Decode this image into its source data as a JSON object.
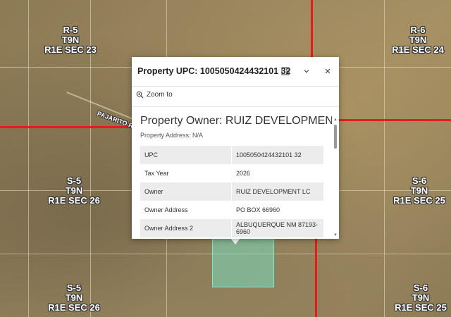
{
  "map": {
    "road_label": "PAJARITO R",
    "section_labels": [
      {
        "lines": [
          "R-5",
          "T9N",
          "R1E SEC 23"
        ]
      },
      {
        "lines": [
          "R-6",
          "T9N",
          "R1E SEC 24"
        ]
      },
      {
        "lines": [
          "S-5",
          "T9N",
          "R1E SEC 26"
        ]
      },
      {
        "lines": [
          "S-6",
          "T9N",
          "R1E SEC 25"
        ]
      },
      {
        "lines": [
          "S-5",
          "T9N",
          "R1E SEC 26"
        ]
      },
      {
        "lines": [
          "S-6",
          "T9N",
          "R1E SEC 25"
        ]
      }
    ]
  },
  "popup": {
    "title": "Property UPC: 1005050424432101 32",
    "zoom_label": "Zoom to",
    "owner_heading": "Property Owner: RUIZ DEVELOPMENT LC",
    "property_address": "Property Address: N/A",
    "attributes": [
      {
        "key": "UPC",
        "value": "1005050424432101 32"
      },
      {
        "key": "Tax Year",
        "value": "2026"
      },
      {
        "key": "Owner",
        "value": "RUIZ DEVELOPMENT LC"
      },
      {
        "key": "Owner Address",
        "value": "PO BOX 66960"
      },
      {
        "key": "Owner Address 2",
        "value": "ALBUQUERQUE NM 87193-6960"
      }
    ]
  },
  "icons": {
    "dock": "dock-icon",
    "collapse": "chevron-down-icon",
    "close": "close-icon",
    "zoom": "zoom-in-icon"
  },
  "colors": {
    "section_line": "#e01e1e",
    "parcel_highlight": "#6ff0d0"
  }
}
